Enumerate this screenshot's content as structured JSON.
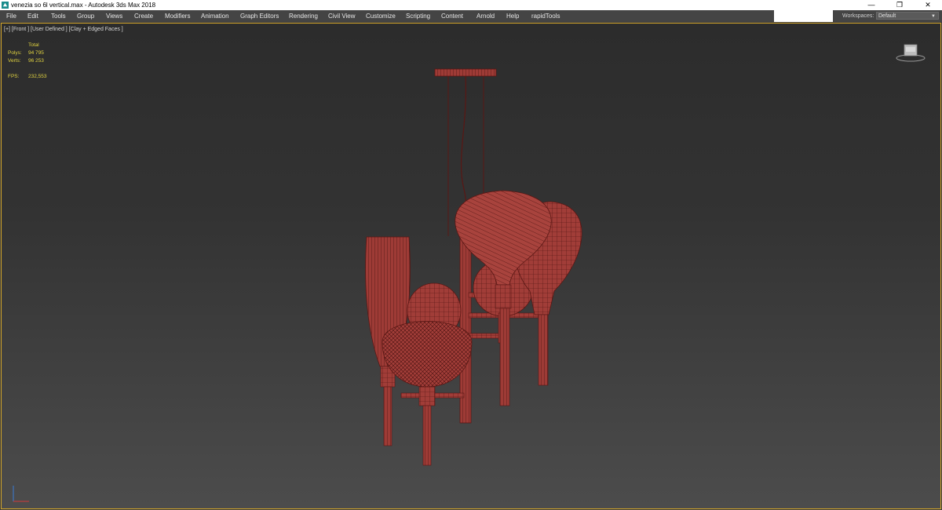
{
  "window": {
    "title": "venezia so 6l vertical.max - Autodesk 3ds Max 2018",
    "minimize_icon": "minimize-icon",
    "restore_icon": "restore-icon",
    "close_icon": "close-icon"
  },
  "menu": {
    "items": [
      "File",
      "Edit",
      "Tools",
      "Group",
      "Views",
      "Create",
      "Modifiers",
      "Animation",
      "Graph Editors",
      "Rendering",
      "Civil View",
      "Customize",
      "Scripting",
      "Content",
      "Arnold",
      "Help",
      "rapidTools"
    ]
  },
  "workspaces": {
    "label": "Workspaces:",
    "value": "Default"
  },
  "viewport": {
    "label": "[+] [Front ] [User Defined ] [Clay + Edged Faces ]",
    "stats": {
      "header": "Total",
      "polys_label": "Polys:",
      "polys_value": "94 795",
      "verts_label": "Verts:",
      "verts_value": "96 253",
      "fps_label": "FPS:",
      "fps_value": "232,553"
    }
  },
  "colors": {
    "accent_border": "#d2a52a",
    "model": "#9a3a35",
    "stats_text": "#e0d240"
  }
}
